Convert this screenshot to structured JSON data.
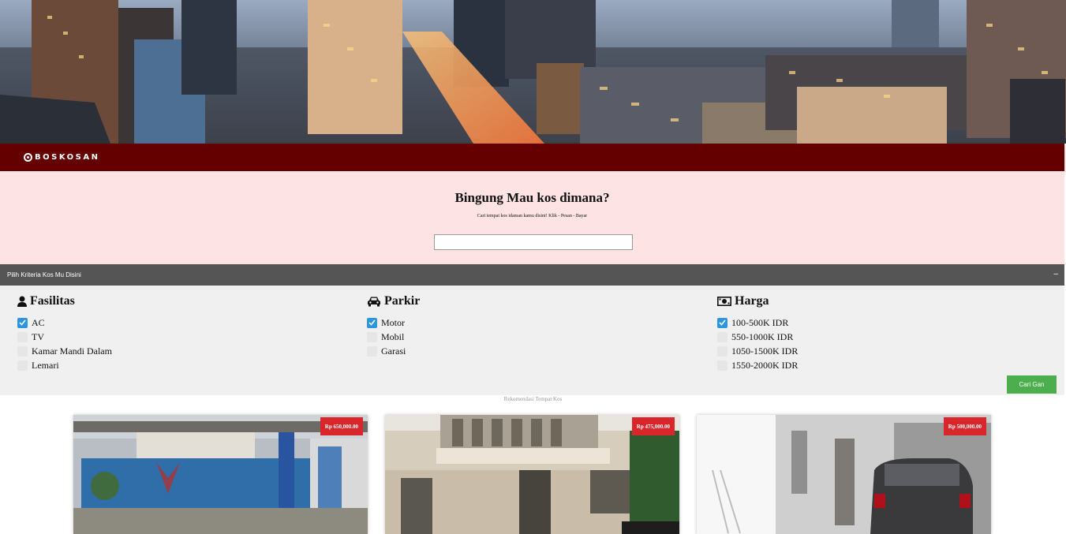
{
  "brand": {
    "name": "BOSKOSAN",
    "icon": "circle-logo-icon"
  },
  "search": {
    "title": "Bingung Mau kos dimana?",
    "subtitle": "Cari tempat kos idaman kamu disini! Klik - Pesan - Bayar",
    "placeholder": ""
  },
  "criteria": {
    "label": "Pilih Kriteria Kos Mu Disini",
    "toggle": "–"
  },
  "filters": {
    "fasilitas": {
      "title": "Fasilitas",
      "icon": "user-icon",
      "options": [
        {
          "label": "AC",
          "checked": true
        },
        {
          "label": "TV",
          "checked": false
        },
        {
          "label": "Kamar Mandi Dalam",
          "checked": false
        },
        {
          "label": "Lemari",
          "checked": false
        }
      ]
    },
    "parkir": {
      "title": "Parkir",
      "icon": "car-icon",
      "options": [
        {
          "label": "Motor",
          "checked": true
        },
        {
          "label": "Mobil",
          "checked": false
        },
        {
          "label": "Garasi",
          "checked": false
        }
      ]
    },
    "harga": {
      "title": "Harga",
      "icon": "money-icon",
      "options": [
        {
          "label": "100-500K IDR",
          "checked": true
        },
        {
          "label": "550-1000K IDR",
          "checked": false
        },
        {
          "label": "1050-1500K IDR",
          "checked": false
        },
        {
          "label": "1550-2000K IDR",
          "checked": false
        }
      ]
    }
  },
  "cari_button": "Cari Gan",
  "recommendations": {
    "title": "Rekomendasi Tempat Kos",
    "cards": [
      {
        "price": "Rp 650,000.00"
      },
      {
        "price": "Rp 475,000.00"
      },
      {
        "price": "Rp 500,000.00"
      }
    ]
  },
  "colors": {
    "brand_bar": "#640000",
    "search_bg": "#fde3e3",
    "criteria_bar": "#555555",
    "filter_bg": "#f0f0f0",
    "checkbox_checked": "#2b95e0",
    "button_green": "#4cae4c",
    "price_badge": "#d9262a"
  }
}
